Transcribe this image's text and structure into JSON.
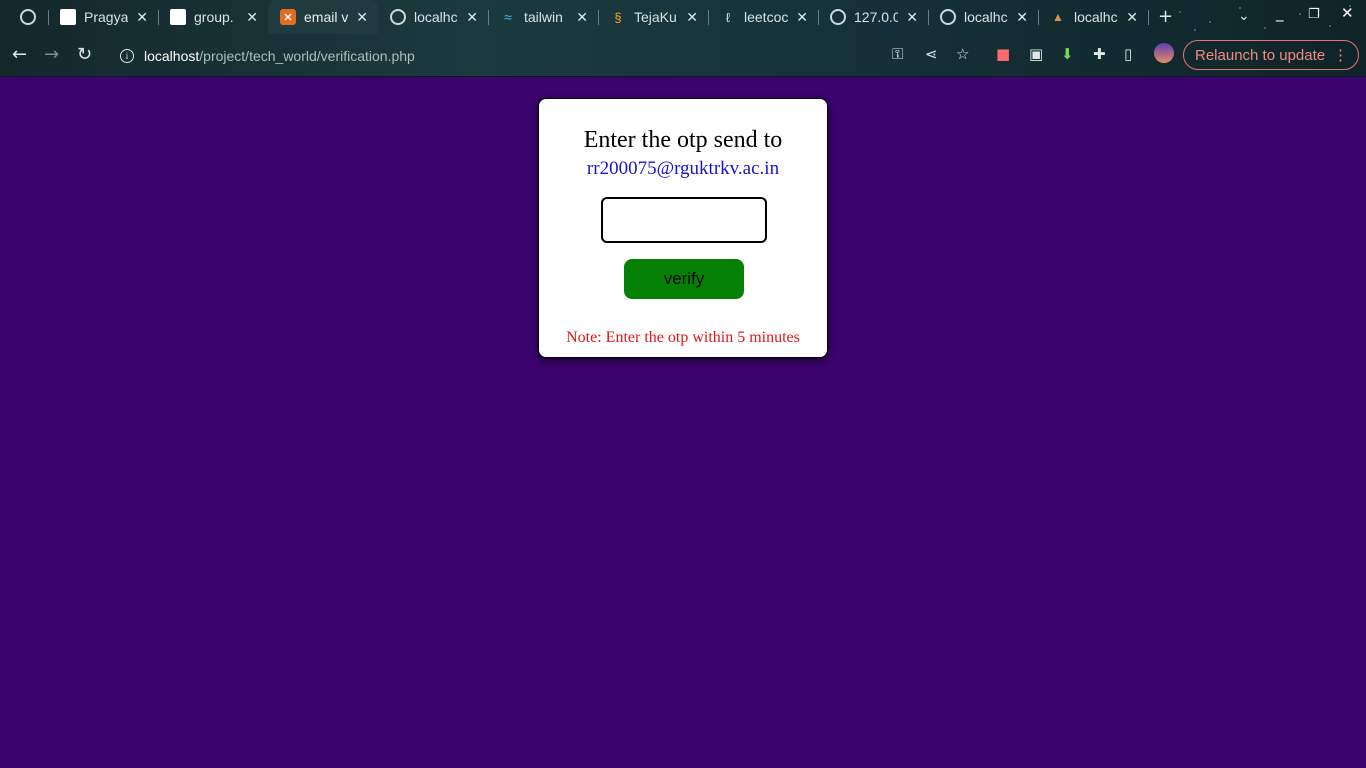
{
  "browser": {
    "tabs": [
      {
        "title": "",
        "icon": "chatgpt-icon"
      },
      {
        "title": "Pragya",
        "icon": "document-icon"
      },
      {
        "title": "group.",
        "icon": "document-icon"
      },
      {
        "title": "email v",
        "icon": "xampp-icon",
        "active": true
      },
      {
        "title": "localhc",
        "icon": "globe-icon"
      },
      {
        "title": "tailwin",
        "icon": "tailwind-icon"
      },
      {
        "title": "TejaKu",
        "icon": "tejaku-icon"
      },
      {
        "title": "leetcoc",
        "icon": "leetcode-icon"
      },
      {
        "title": "127.0.0",
        "icon": "globe-icon"
      },
      {
        "title": "localhc",
        "icon": "globe-icon"
      },
      {
        "title": "localhc",
        "icon": "localhost-icon"
      }
    ],
    "url_host": "localhost",
    "url_path": "/project/tech_world/verification.php",
    "relaunch_label": "Relaunch to update",
    "accent": "#f28b82"
  },
  "page": {
    "background": "#3b036d",
    "heading": "Enter the otp send to",
    "email": "rr200075@rguktrkv.ac.in",
    "otp_value": "",
    "verify_label": "verify",
    "note": "Note: Enter the otp within 5 minutes",
    "button_color": "#048105",
    "note_color": "#e41616"
  }
}
